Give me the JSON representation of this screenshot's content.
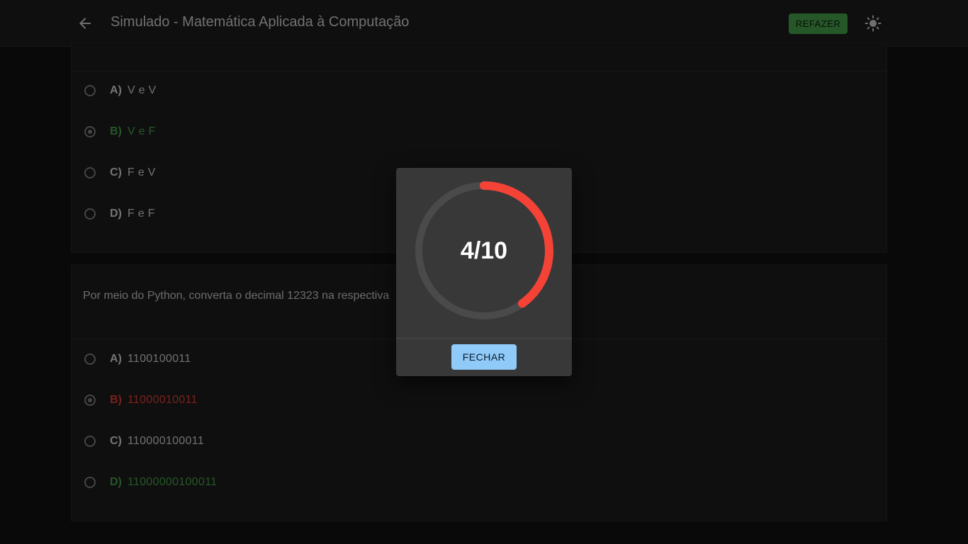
{
  "header": {
    "title": "Simulado - Matemática Aplicada à Computação",
    "redo_label": "REFAZER",
    "icons": [
      "arrow-left-icon",
      "sun-icon"
    ]
  },
  "questions": [
    {
      "text": "",
      "options": [
        {
          "letter": "A)",
          "text": "V e V",
          "state": "normal"
        },
        {
          "letter": "B)",
          "text": "V e F",
          "state": "correct-selected"
        },
        {
          "letter": "C)",
          "text": "F e V",
          "state": "normal"
        },
        {
          "letter": "D)",
          "text": "F e F",
          "state": "normal"
        }
      ]
    },
    {
      "text": "Por meio do Python, converta o decimal 12323 na respectiva",
      "options": [
        {
          "letter": "A)",
          "text": "1100100011",
          "state": "normal"
        },
        {
          "letter": "B)",
          "text": "11000010011",
          "state": "wrong-selected"
        },
        {
          "letter": "C)",
          "text": "110000100011",
          "state": "normal"
        },
        {
          "letter": "D)",
          "text": "11000000100011",
          "state": "correct"
        }
      ]
    }
  ],
  "result_dialog": {
    "score": "4/10",
    "score_fraction": 0.4,
    "close_label": "FECHAR"
  },
  "colors": {
    "correct": "#4caf50",
    "wrong": "#f44336",
    "gauge_track": "#4a4a4a",
    "gauge_progress": "#f44336",
    "primary_button": "#90caf9"
  }
}
